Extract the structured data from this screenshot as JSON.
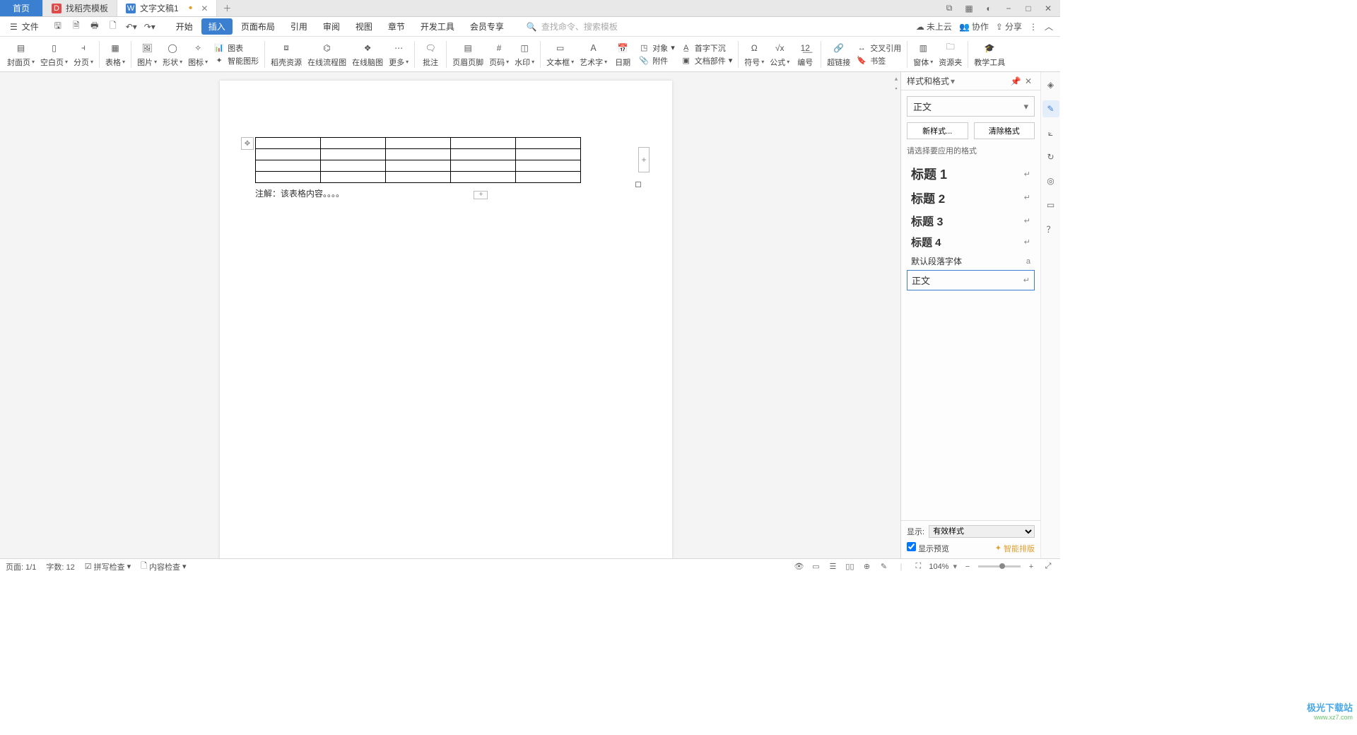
{
  "tabs": {
    "home": "首页",
    "template": "找稻壳模板",
    "doc": "文字文稿1"
  },
  "window_controls": {
    "min": "−",
    "max": "□",
    "close": "✕"
  },
  "file_label": "文件",
  "menus": [
    "开始",
    "插入",
    "页面布局",
    "引用",
    "审阅",
    "视图",
    "章节",
    "开发工具",
    "会员专享"
  ],
  "active_menu_index": 1,
  "search_placeholder": "查找命令、搜索模板",
  "top_right": {
    "cloud": "未上云",
    "coop": "协作",
    "share": "分享"
  },
  "ribbon": {
    "cover": "封面页",
    "blank": "空白页",
    "break": "分页",
    "table": "表格",
    "picture": "图片",
    "shape": "形状",
    "icons": "图标",
    "chart": "图表",
    "smart_shape": "智能图形",
    "doxres": "稻壳资源",
    "online_flow": "在线流程图",
    "online_mind": "在线脑图",
    "more": "更多",
    "comment": "批注",
    "header_footer": "页眉页脚",
    "page_number": "页码",
    "watermark": "水印",
    "textbox": "文本框",
    "wordart": "艺术字",
    "date": "日期",
    "object": "对象",
    "attachment": "附件",
    "dropcap": "首字下沉",
    "doc_parts": "文档部件",
    "symbol": "符号",
    "equation": "公式",
    "number": "编号",
    "hyperlink": "超链接",
    "crossref": "交叉引用",
    "bookmark": "书签",
    "form": "窗体",
    "resource": "资源夹",
    "teaching": "教学工具"
  },
  "document": {
    "caption": "注解：该表格内容。。。。",
    "table": {
      "rows": 4,
      "cols": 5
    }
  },
  "styles_panel": {
    "title": "样式和格式",
    "current": "正文",
    "new_style": "新样式...",
    "clear_format": "清除格式",
    "hint": "请选择要应用的格式",
    "items": [
      {
        "name": "标题 1",
        "cls": "h1"
      },
      {
        "name": "标题 2",
        "cls": "h2"
      },
      {
        "name": "标题 3",
        "cls": "h3"
      },
      {
        "name": "标题 4",
        "cls": "h4"
      },
      {
        "name": "默认段落字体",
        "cls": "def",
        "mark": "a"
      },
      {
        "name": "正文",
        "cls": "body"
      }
    ],
    "show_label": "显示:",
    "show_value": "有效样式",
    "preview_label": "显示预览",
    "smart_layout": "智能排版"
  },
  "statusbar": {
    "page": "页面: 1/1",
    "words": "字数: 12",
    "spellcheck": "拼写检查",
    "content_check": "内容检查",
    "zoom": "104%"
  },
  "watermark": {
    "line1": "极光下载站",
    "line2": "www.xz7.com"
  }
}
